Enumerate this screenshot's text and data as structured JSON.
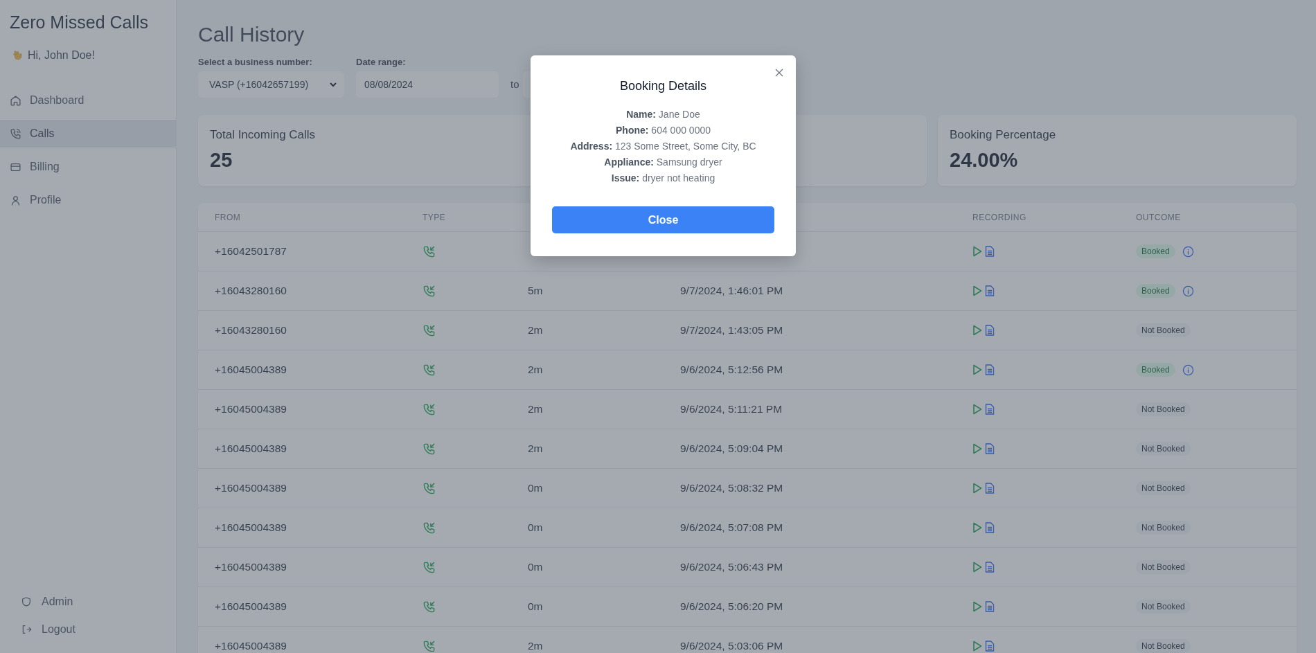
{
  "sidebar": {
    "app_title": "Zero Missed Calls",
    "greeting": "Hi, John Doe!",
    "items": [
      {
        "label": "Dashboard",
        "kind": "home",
        "selected": false
      },
      {
        "label": "Calls",
        "kind": "phone",
        "selected": true
      },
      {
        "label": "Billing",
        "kind": "card",
        "selected": false
      },
      {
        "label": "Profile",
        "kind": "user",
        "selected": false
      }
    ],
    "footer_items": [
      {
        "label": "Admin",
        "kind": "shield"
      },
      {
        "label": "Logout",
        "kind": "logout"
      }
    ]
  },
  "page": {
    "title": "Call History",
    "business_label": "Select a business number:",
    "business_value": "VASP (+16042657199)",
    "date_label": "Date range:",
    "date_from": "08/08/2024",
    "to_label": "to"
  },
  "stats": [
    {
      "kind": "shown",
      "title": "Total Incoming Calls",
      "value": "25"
    },
    {
      "kind": "covered"
    },
    {
      "kind": "shown",
      "title": "Booking Percentage",
      "value": "24.00%"
    }
  ],
  "table": {
    "columns": [
      {
        "kind": "shown",
        "label": "FROM"
      },
      {
        "kind": "shown",
        "label": "TYPE"
      },
      {
        "kind": "covered"
      },
      {
        "kind": "covered"
      },
      {
        "kind": "shown",
        "label": "RECORDING"
      },
      {
        "kind": "shown",
        "label": "OUTCOME"
      }
    ],
    "rows": [
      {
        "from": "+16042501787",
        "kind": "incoming",
        "outcome": "Booked",
        "booked": true
      },
      {
        "from": "+16043280160",
        "kind": "incoming",
        "duration": "5m",
        "time": "9/7/2024, 1:46:01 PM",
        "outcome": "Booked",
        "booked": true
      },
      {
        "from": "+16043280160",
        "kind": "incoming",
        "duration": "2m",
        "time": "9/7/2024, 1:43:05 PM",
        "outcome": "Not Booked",
        "booked": false
      },
      {
        "from": "+16045004389",
        "kind": "incoming",
        "duration": "2m",
        "time": "9/6/2024, 5:12:56 PM",
        "outcome": "Booked",
        "booked": true
      },
      {
        "from": "+16045004389",
        "kind": "incoming",
        "duration": "2m",
        "time": "9/6/2024, 5:11:21 PM",
        "outcome": "Not Booked",
        "booked": false
      },
      {
        "from": "+16045004389",
        "kind": "incoming",
        "duration": "2m",
        "time": "9/6/2024, 5:09:04 PM",
        "outcome": "Not Booked",
        "booked": false
      },
      {
        "from": "+16045004389",
        "kind": "incoming",
        "duration": "0m",
        "time": "9/6/2024, 5:08:32 PM",
        "outcome": "Not Booked",
        "booked": false
      },
      {
        "from": "+16045004389",
        "kind": "incoming",
        "duration": "0m",
        "time": "9/6/2024, 5:07:08 PM",
        "outcome": "Not Booked",
        "booked": false
      },
      {
        "from": "+16045004389",
        "kind": "incoming",
        "duration": "0m",
        "time": "9/6/2024, 5:06:43 PM",
        "outcome": "Not Booked",
        "booked": false
      },
      {
        "from": "+16045004389",
        "kind": "incoming",
        "duration": "0m",
        "time": "9/6/2024, 5:06:20 PM",
        "outcome": "Not Booked",
        "booked": false
      },
      {
        "from": "+16045004389",
        "kind": "incoming",
        "duration": "2m",
        "time": "9/6/2024, 5:03:06 PM",
        "outcome": "Not Booked",
        "booked": false
      }
    ]
  },
  "modal": {
    "title": "Booking Details",
    "lines": [
      "**Name:** Jane Doe",
      "**Phone:** 604 000 0000",
      "**Address:** 123 Some Street, Some City, BC",
      "**Appliance:** Samsung dryer",
      "**Issue:** dryer not heating"
    ],
    "button": "Close"
  }
}
